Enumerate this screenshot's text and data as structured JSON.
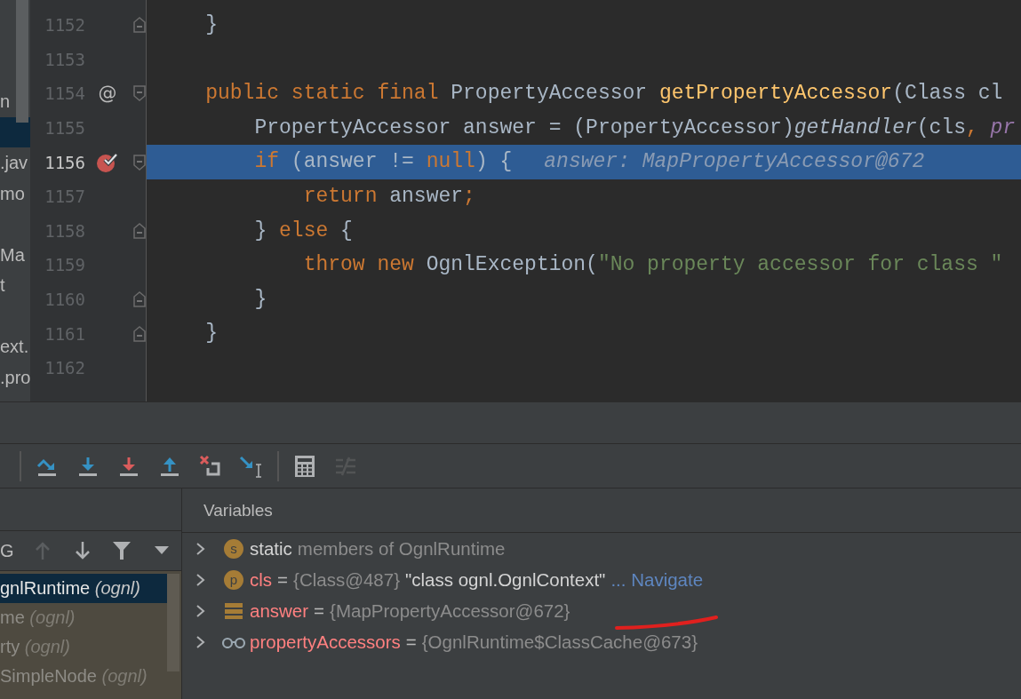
{
  "project_tree": {
    "items": [
      {
        "label": "n",
        "selected": false
      },
      {
        "selected": true
      },
      {
        "label": ".jav",
        "selected": false
      },
      {
        "label": "mo",
        "selected": false
      },
      {
        "selected": false
      },
      {
        "label": "Ma",
        "selected": false
      },
      {
        "label": "t",
        "selected": false
      },
      {
        "selected": false
      },
      {
        "label": "ext.",
        "selected": false
      },
      {
        "label": ".pro",
        "selected": false
      }
    ]
  },
  "editor": {
    "lines": [
      {
        "number": "1152",
        "current": false,
        "breakpoint": false,
        "fold": {
          "kind": "end"
        },
        "tokens": [
          {
            "text": "    }",
            "kind": "plain"
          }
        ]
      },
      {
        "number": "1153",
        "current": false,
        "breakpoint": false
      },
      {
        "number": "1154",
        "current": false,
        "breakpoint": false,
        "gutter_mark": "@",
        "fold": {
          "kind": "start"
        },
        "tokens": [
          {
            "text": "    public static final ",
            "kind": "kw"
          },
          {
            "text": "PropertyAccessor ",
            "kind": "plain"
          },
          {
            "text": "getPropertyAccessor",
            "kind": "decl"
          },
          {
            "text": "(Class cl",
            "kind": "plain"
          }
        ]
      },
      {
        "number": "1155",
        "current": false,
        "breakpoint": false,
        "tokens": [
          {
            "text": "        PropertyAccessor answer = (PropertyAccessor)",
            "kind": "plain"
          },
          {
            "text": "getHandler",
            "kind": "italic"
          },
          {
            "text": "(cls",
            "kind": "plain"
          },
          {
            "text": ", ",
            "kind": "kw"
          },
          {
            "text": "pr",
            "kind": "param"
          }
        ]
      },
      {
        "number": "1156",
        "current": true,
        "breakpoint": true,
        "fold": {
          "kind": "start"
        },
        "tokens": [
          {
            "text": "        if",
            "kind": "kw"
          },
          {
            "text": " (answer != ",
            "kind": "plain"
          },
          {
            "text": "null",
            "kind": "kw"
          },
          {
            "text": ") {",
            "kind": "plain"
          },
          {
            "text": "answer: MapPropertyAccessor@672",
            "kind": "hint"
          }
        ]
      },
      {
        "number": "1157",
        "current": false,
        "breakpoint": false,
        "tokens": [
          {
            "text": "            return",
            "kind": "kw"
          },
          {
            "text": " answer",
            "kind": "plain"
          },
          {
            "text": ";",
            "kind": "kw"
          }
        ]
      },
      {
        "number": "1158",
        "current": false,
        "breakpoint": false,
        "fold": {
          "kind": "end"
        },
        "tokens": [
          {
            "text": "        } ",
            "kind": "plain"
          },
          {
            "text": "else",
            "kind": "kw"
          },
          {
            "text": " {",
            "kind": "plain"
          }
        ]
      },
      {
        "number": "1159",
        "current": false,
        "breakpoint": false,
        "tokens": [
          {
            "text": "            throw new ",
            "kind": "kw"
          },
          {
            "text": "OgnlException(",
            "kind": "plain"
          },
          {
            "text": "\"No property accessor for class \"",
            "kind": "str"
          }
        ]
      },
      {
        "number": "1160",
        "current": false,
        "breakpoint": false,
        "fold": {
          "kind": "end"
        },
        "tokens": [
          {
            "text": "        }",
            "kind": "plain"
          }
        ]
      },
      {
        "number": "1161",
        "current": false,
        "breakpoint": false,
        "fold": {
          "kind": "end"
        },
        "tokens": [
          {
            "text": "    }",
            "kind": "plain"
          }
        ]
      },
      {
        "number": "1162",
        "current": false,
        "breakpoint": false
      }
    ]
  },
  "debug_toolbar": {
    "buttons": [
      {
        "kind": "step-over",
        "disabled": false
      },
      {
        "kind": "step-into",
        "disabled": false
      },
      {
        "kind": "force-step-into",
        "disabled": false
      },
      {
        "kind": "step-out",
        "disabled": false
      },
      {
        "kind": "drop-frame",
        "disabled": false
      },
      {
        "kind": "run-to-cursor",
        "disabled": false
      },
      {
        "kind": "separator"
      },
      {
        "kind": "evaluate",
        "disabled": false
      },
      {
        "kind": "trace",
        "disabled": true
      }
    ]
  },
  "frames": {
    "toolbar": {
      "label": "G",
      "buttons": [
        {
          "kind": "up",
          "disabled": true
        },
        {
          "kind": "down",
          "disabled": false
        },
        {
          "kind": "filter",
          "disabled": false
        },
        {
          "kind": "dropdown",
          "disabled": false
        }
      ]
    },
    "items": [
      {
        "method": "gnlRuntime",
        "package": "(ognl)",
        "selected": true
      },
      {
        "method": "me",
        "package": "(ognl)",
        "selected": false
      },
      {
        "method": "rty",
        "package": "(ognl)",
        "selected": false
      },
      {
        "method": "SimpleNode",
        "package": "(ognl)",
        "selected": false
      }
    ]
  },
  "variables": {
    "title": "Variables",
    "rows": [
      {
        "kind": "static",
        "badge": "s",
        "tokens": [
          {
            "text": "static",
            "kind": "value"
          },
          {
            "text": "members of OgnlRuntime",
            "kind": "type"
          }
        ]
      },
      {
        "kind": "param",
        "badge": "p",
        "tokens": [
          {
            "text": "cls",
            "kind": "name"
          },
          {
            "text": "=",
            "kind": "op"
          },
          {
            "text": "{Class@487}",
            "kind": "type"
          },
          {
            "text": "\"class ognl.OgnlContext\"",
            "kind": "value"
          },
          {
            "text": "... Navigate",
            "kind": "link"
          }
        ]
      },
      {
        "kind": "local",
        "tokens": [
          {
            "text": "answer",
            "kind": "name"
          },
          {
            "text": "=",
            "kind": "op"
          },
          {
            "text": "{MapPropertyAccessor@672}",
            "kind": "type"
          }
        ],
        "underlined": true
      },
      {
        "kind": "watch",
        "tokens": [
          {
            "text": "propertyAccessors",
            "kind": "name"
          },
          {
            "text": "=",
            "kind": "op"
          },
          {
            "text": "{OgnlRuntime$ClassCache@673}",
            "kind": "type"
          }
        ]
      }
    ]
  }
}
